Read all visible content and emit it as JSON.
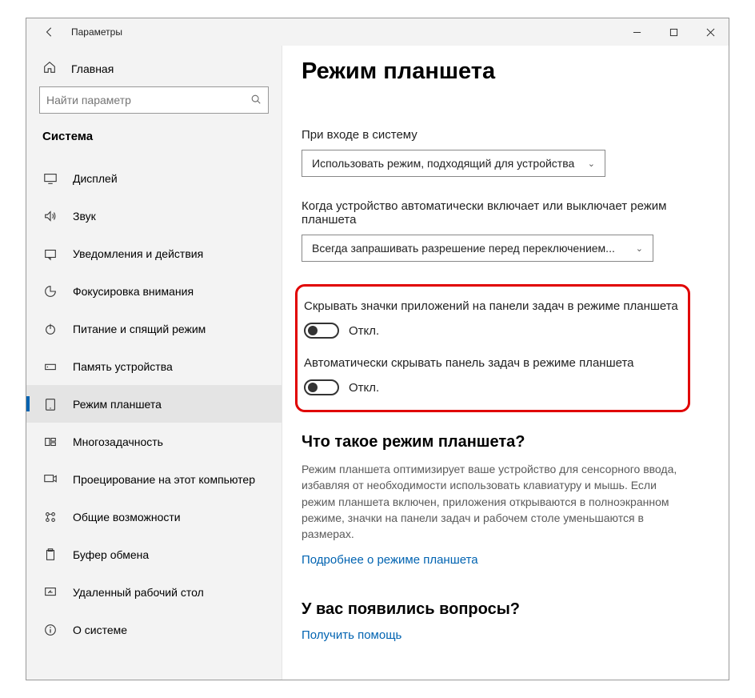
{
  "titlebar": {
    "title": "Параметры"
  },
  "sidebar": {
    "home": "Главная",
    "search_placeholder": "Найти параметр",
    "category": "Система",
    "items": [
      {
        "label": "Дисплей"
      },
      {
        "label": "Звук"
      },
      {
        "label": "Уведомления и действия"
      },
      {
        "label": "Фокусировка внимания"
      },
      {
        "label": "Питание и спящий режим"
      },
      {
        "label": "Память устройства"
      },
      {
        "label": "Режим планшета"
      },
      {
        "label": "Многозадачность"
      },
      {
        "label": "Проецирование на этот компьютер"
      },
      {
        "label": "Общие возможности"
      },
      {
        "label": "Буфер обмена"
      },
      {
        "label": "Удаленный рабочий стол"
      },
      {
        "label": "О системе"
      }
    ]
  },
  "main": {
    "heading": "Режим планшета",
    "signin_label": "При входе в систему",
    "signin_value": "Использовать режим, подходящий для устройства",
    "auto_label": "Когда устройство автоматически включает или выключает режим планшета",
    "auto_value": "Всегда запрашивать разрешение перед переключением...",
    "toggle1_label": "Скрывать значки приложений на панели задач в режиме планшета",
    "toggle1_state": "Откл.",
    "toggle2_label": "Автоматически скрывать панель задач в режиме планшета",
    "toggle2_state": "Откл.",
    "about_heading": "Что такое режим планшета?",
    "about_desc": "Режим планшета оптимизирует ваше устройство для сенсорного ввода, избавляя от необходимости использовать клавиатуру и мышь. Если режим планшета включен, приложения открываются в полноэкранном режиме, значки на панели задач и рабочем столе уменьшаются в размерах.",
    "about_link": "Подробнее о режиме планшета",
    "help_heading": "У вас появились вопросы?",
    "help_link": "Получить помощь"
  }
}
